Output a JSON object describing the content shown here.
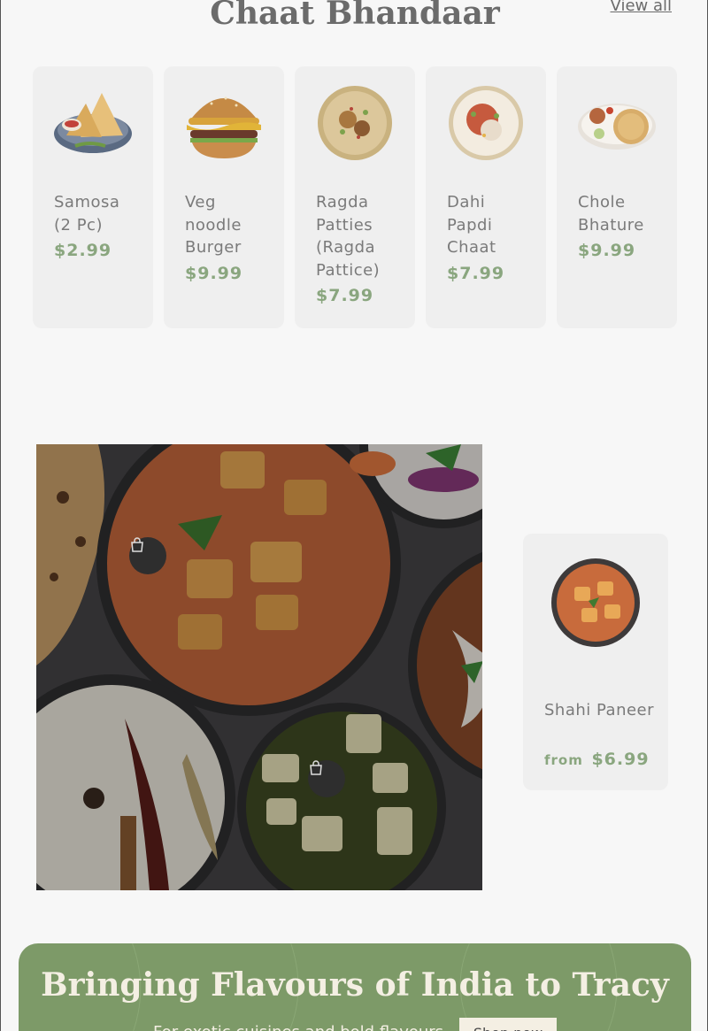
{
  "collection": {
    "title": "Chaat Bhandaar",
    "view_all": "View all",
    "products": [
      {
        "name": "Samosa (2 Pc)",
        "price": "$2.99",
        "icon": "samosa-plate-icon"
      },
      {
        "name": "Veg noodle Burger",
        "price": "$9.99",
        "icon": "burger-icon"
      },
      {
        "name": "Ragda Patties (Ragda Pattice)",
        "price": "$7.99",
        "icon": "ragda-bowl-icon"
      },
      {
        "name": "Dahi Papdi Chaat",
        "price": "$7.99",
        "icon": "papdi-chaat-plate-icon"
      },
      {
        "name": "Chole Bhature",
        "price": "$9.99",
        "icon": "chole-bhature-plate-icon"
      }
    ]
  },
  "featured": {
    "image_icon": "indian-curry-spread-image",
    "product": {
      "name": "Shahi Paneer",
      "from_label": "from",
      "price": "$6.99",
      "icon": "paneer-curry-bowl-icon"
    }
  },
  "banner": {
    "title": "Bringing Flavours of India to Tracy",
    "subtitle": "For exotic cuisines and bold flavours",
    "button": "Shop now"
  },
  "colors": {
    "price_green": "#8aa67f",
    "banner_green": "#7d9a68",
    "card_bg": "#efefef"
  }
}
